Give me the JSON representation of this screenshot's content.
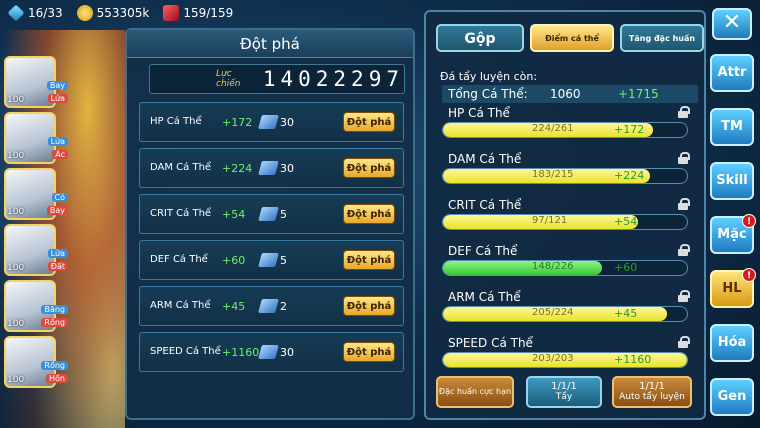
{
  "topbar": {
    "gems": "16/33",
    "gold": "553305k",
    "energy": "159/159"
  },
  "heroes": [
    {
      "level": "100",
      "tag1": "Bay",
      "tag2": "Lửa"
    },
    {
      "level": "100",
      "tag1": "Lửa",
      "tag2": "Ác"
    },
    {
      "level": "100",
      "tag1": "Cỏ",
      "tag2": "Bay"
    },
    {
      "level": "100",
      "tag1": "Lửa",
      "tag2": "Đất"
    },
    {
      "level": "100",
      "tag1": "Băng",
      "tag2": "Rồng"
    },
    {
      "level": "100",
      "tag1": "Rồng",
      "tag2": "Hồn"
    }
  ],
  "breakthrough": {
    "title": "Đột phá",
    "power_label": "Lực chiến",
    "power_value": "14022297",
    "button_label": "Đột phá",
    "stats": [
      {
        "name": "HP Cá Thể",
        "bonus": "+172",
        "cost": "30"
      },
      {
        "name": "DAM Cá Thể",
        "bonus": "+224",
        "cost": "30"
      },
      {
        "name": "CRIT Cá Thể",
        "bonus": "+54",
        "cost": "5"
      },
      {
        "name": "DEF Cá Thể",
        "bonus": "+60",
        "cost": "5"
      },
      {
        "name": "ARM Cá Thể",
        "bonus": "+45",
        "cost": "2"
      },
      {
        "name": "SPEED Cá Thể",
        "bonus": "+1160",
        "cost": "30"
      }
    ]
  },
  "training": {
    "tabs": {
      "gop": "Gộp",
      "diem": "Điểm cá thể",
      "tang": "Tăng đặc huấn"
    },
    "remain_label": "Đá tẩy luyện còn:",
    "total_label": "Tổng Cá Thể:",
    "total_value": "1060",
    "total_bonus": "+1715",
    "stats": [
      {
        "name": "HP Cá Thể",
        "values": "224/261",
        "bonus": "+172",
        "fill": 0.86,
        "color": "yellow"
      },
      {
        "name": "DAM Cá Thể",
        "values": "183/215",
        "bonus": "+224",
        "fill": 0.85,
        "color": "yellow"
      },
      {
        "name": "CRIT Cá Thể",
        "values": "97/121",
        "bonus": "+54",
        "fill": 0.8,
        "color": "yellow"
      },
      {
        "name": "DEF Cá Thể",
        "values": "148/226",
        "bonus": "+60",
        "fill": 0.65,
        "color": "green"
      },
      {
        "name": "ARM Cá Thể",
        "values": "205/224",
        "bonus": "+45",
        "fill": 0.92,
        "color": "yellow"
      },
      {
        "name": "SPEED Cá Thể",
        "values": "203/203",
        "bonus": "+1160",
        "fill": 1.0,
        "color": "yellow"
      }
    ],
    "bottom": {
      "special": "Đặc huấn cực hạn",
      "tay_ratio": "1/1/1",
      "tay_label": "Tẩy",
      "auto_ratio": "1/1/1",
      "auto_label": "Auto tẩy luyện"
    }
  },
  "side_tabs": [
    {
      "label": "Attr",
      "badge": ""
    },
    {
      "label": "TM",
      "badge": ""
    },
    {
      "label": "Skill",
      "badge": ""
    },
    {
      "label": "Mặc",
      "badge": "!"
    },
    {
      "label": "HL",
      "badge": "!"
    },
    {
      "label": "Hóa",
      "badge": ""
    },
    {
      "label": "Gen",
      "badge": ""
    }
  ],
  "close_label": "✕"
}
